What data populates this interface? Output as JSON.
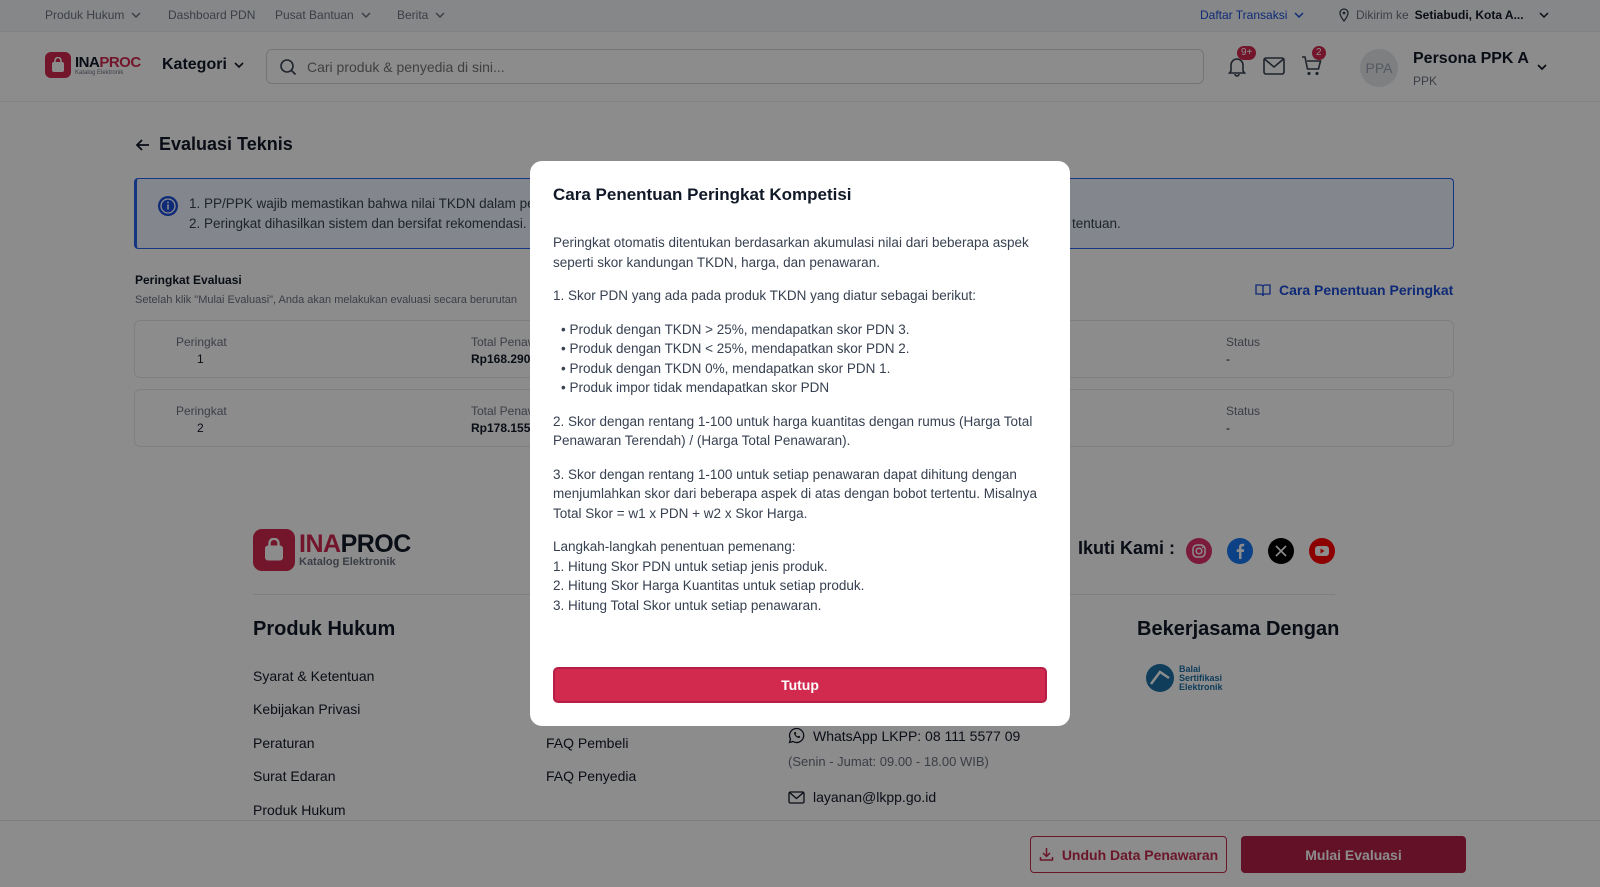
{
  "utility_bar": {
    "produk_hukum": "Produk Hukum",
    "dashboard_pdn": "Dashboard PDN",
    "pusat_bantuan": "Pusat Bantuan",
    "berita": "Berita",
    "daftar_transaksi": "Daftar Transaksi",
    "dikirim_label": "Dikirim ke",
    "dikirim_value": "Setiabudi, Kota A..."
  },
  "header": {
    "logo_brand": "INA",
    "logo_brand_accent": "PROC",
    "logo_sub": "Katalog Elektronik",
    "kategori": "Kategori",
    "search_placeholder": "Cari produk & penyedia di sini...",
    "notif_badge": "9+",
    "cart_badge": "2",
    "avatar_initials": "PPA",
    "user_name": "Persona PPK A",
    "user_role": "PPK"
  },
  "page": {
    "title": "Evaluasi Teknis",
    "info_line1": "1. PP/PPK wajib memastikan bahwa nilai TKDN dalam pe",
    "info_line2": "2. Peringkat dihasilkan sistem dan bersifat rekomendasi.",
    "info_line2_tail": "tentuan.",
    "section_title": "Peringkat Evaluasi",
    "section_desc": "Setelah klik \"Mulai Evaluasi\", Anda akan melakukan evaluasi secara berurutan",
    "cara_link": "Cara Penentuan Peringkat",
    "ranks": [
      {
        "label_rank": "Peringkat",
        "rank": "1",
        "label_total": "Total Penaw",
        "total": "Rp168.290.",
        "label_status": "Status",
        "status": "-"
      },
      {
        "label_rank": "Peringkat",
        "rank": "2",
        "label_total": "Total Penaw",
        "total": "Rp178.155.",
        "label_status": "Status",
        "status": "-"
      }
    ]
  },
  "footer": {
    "follow": "Ikuti Kami :",
    "produk_hukum_heading": "Produk Hukum",
    "links": [
      "Syarat & Ketentuan",
      "Kebijakan Privasi",
      "Peraturan",
      "Surat Edaran",
      "Produk Hukum"
    ],
    "faq_pembeli": "FAQ Pembeli",
    "faq_penyedia": "FAQ Penyedia",
    "whatsapp": "WhatsApp LKPP: 08 111 5577 09",
    "hours": "(Senin - Jumat: 09.00 - 18.00 WIB)",
    "email": "layanan@lkpp.go.id",
    "kerjasama_heading": "Bekerjasama Dengan",
    "bsre_lines": [
      "Balai",
      "Sertifikasi",
      "Elektronik"
    ]
  },
  "action_bar": {
    "download": "Unduh Data Penawaran",
    "start": "Mulai Evaluasi"
  },
  "modal": {
    "title": "Cara Penentuan Peringkat Kompetisi",
    "intro": "Peringkat otomatis ditentukan berdasarkan akumulasi nilai dari beberapa aspek seperti skor kandungan TKDN, harga, dan penawaran.",
    "point1": "1. Skor PDN yang ada pada produk TKDN yang diatur sebagai berikut:",
    "bullets": [
      "Produk dengan TKDN > 25%, mendapatkan skor PDN 3.",
      "Produk dengan TKDN < 25%, mendapatkan skor PDN 2.",
      "Produk dengan TKDN 0%, mendapatkan skor PDN 1.",
      "Produk impor tidak mendapatkan skor PDN"
    ],
    "point2": "2. Skor dengan rentang 1-100 untuk harga kuantitas dengan rumus (Harga Total Penawaran Terendah) / (Harga Total Penawaran).",
    "point3": "3. Skor dengan rentang 1-100 untuk setiap penawaran dapat dihitung dengan menjumlahkan skor dari beberapa aspek di atas dengan bobot tertentu. Misalnya Total Skor = w1 x PDN + w2 x Skor Harga.",
    "steps_title": "Langkah-langkah penentuan pemenang:",
    "steps": [
      "1. Hitung Skor PDN untuk setiap jenis produk.",
      "2. Hitung Skor Harga Kuantitas untuk setiap produk.",
      "3. Hitung Total Skor untuk setiap penawaran."
    ],
    "close_label": "Tutup"
  },
  "colors": {
    "brand": "#d2294f",
    "link": "#1d4ed8",
    "overlay": "rgba(0,0,0,0.45)"
  }
}
